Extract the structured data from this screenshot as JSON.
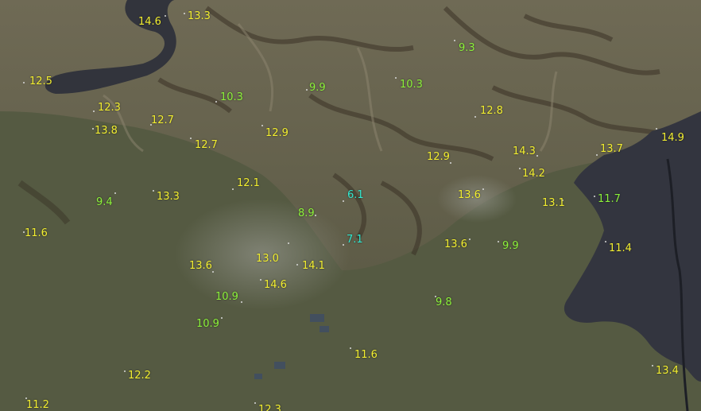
{
  "colors": {
    "warm": "#f2ee30",
    "mild": "#8cf23a",
    "cool": "#30e8d0",
    "water": "#303340",
    "plain": "#5a5e45",
    "hills": "#6b6650",
    "ridge": "#3a2f25"
  },
  "stations": [
    {
      "value": "14.6",
      "cls": "warm"
    },
    {
      "value": "13.3",
      "cls": "warm"
    },
    {
      "value": "12.5",
      "cls": "warm"
    },
    {
      "value": "9.3",
      "cls": "mild"
    },
    {
      "value": "10.3",
      "cls": "mild"
    },
    {
      "value": "9.9",
      "cls": "mild"
    },
    {
      "value": "10.3",
      "cls": "mild"
    },
    {
      "value": "12.3",
      "cls": "warm"
    },
    {
      "value": "12.8",
      "cls": "warm"
    },
    {
      "value": "12.7",
      "cls": "warm"
    },
    {
      "value": "13.8",
      "cls": "warm"
    },
    {
      "value": "12.9",
      "cls": "warm"
    },
    {
      "value": "14.9",
      "cls": "warm"
    },
    {
      "value": "12.7",
      "cls": "warm"
    },
    {
      "value": "14.3",
      "cls": "warm"
    },
    {
      "value": "13.7",
      "cls": "warm"
    },
    {
      "value": "12.9",
      "cls": "warm"
    },
    {
      "value": "14.2",
      "cls": "warm"
    },
    {
      "value": "12.1",
      "cls": "warm"
    },
    {
      "value": "6.1",
      "cls": "cool"
    },
    {
      "value": "13.6",
      "cls": "warm"
    },
    {
      "value": "9.4",
      "cls": "mild"
    },
    {
      "value": "13.3",
      "cls": "warm"
    },
    {
      "value": "13.1",
      "cls": "warm"
    },
    {
      "value": "11.7",
      "cls": "mild"
    },
    {
      "value": "8.9",
      "cls": "mild"
    },
    {
      "value": "11.6",
      "cls": "warm"
    },
    {
      "value": "7.1",
      "cls": "cool"
    },
    {
      "value": "13.6",
      "cls": "warm"
    },
    {
      "value": "9.9",
      "cls": "mild"
    },
    {
      "value": "11.4",
      "cls": "warm"
    },
    {
      "value": "13.0",
      "cls": "warm"
    },
    {
      "value": "14.1",
      "cls": "warm"
    },
    {
      "value": "13.6",
      "cls": "warm"
    },
    {
      "value": "14.6",
      "cls": "warm"
    },
    {
      "value": "10.9",
      "cls": "mild"
    },
    {
      "value": "9.8",
      "cls": "mild"
    },
    {
      "value": "10.9",
      "cls": "mild"
    },
    {
      "value": "11.6",
      "cls": "warm"
    },
    {
      "value": "12.2",
      "cls": "warm"
    },
    {
      "value": "13.4",
      "cls": "warm"
    },
    {
      "value": "11.2",
      "cls": "warm"
    },
    {
      "value": "12.3",
      "cls": "warm"
    }
  ]
}
